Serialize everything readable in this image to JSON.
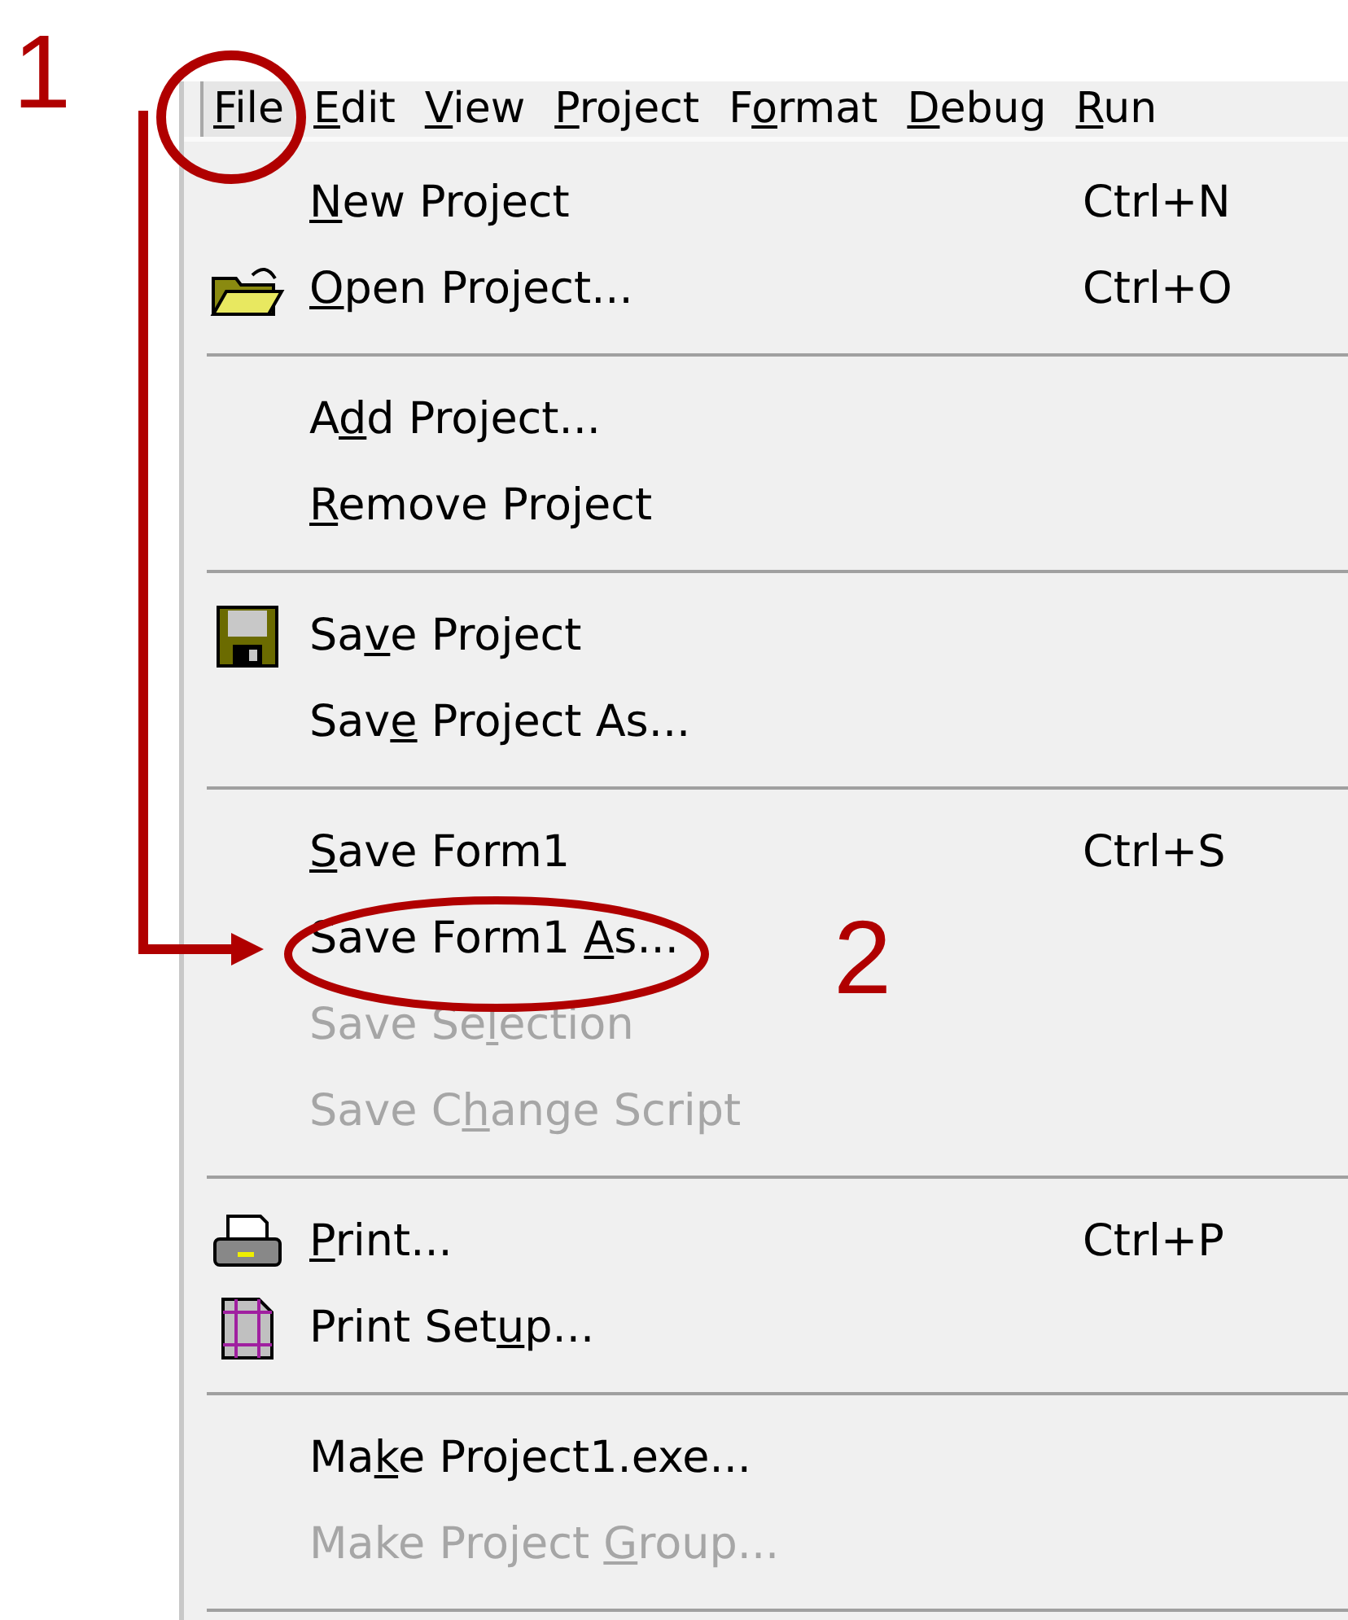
{
  "menu_bar": [
    {
      "key": "F",
      "post": "ile",
      "selected": true
    },
    {
      "key": "E",
      "post": "dit",
      "selected": false
    },
    {
      "key": "V",
      "post": "iew",
      "selected": false
    },
    {
      "key": "P",
      "post": "roject",
      "selected": false
    },
    {
      "pre": "F",
      "key": "o",
      "post": "rmat",
      "selected": false
    },
    {
      "key": "D",
      "post": "ebug",
      "selected": false
    },
    {
      "key": "R",
      "post": "un",
      "selected": false
    }
  ],
  "file_menu": {
    "groups": [
      [
        {
          "kind": "plain",
          "key": "N",
          "post": "ew Project",
          "shortcut": "Ctrl+N",
          "disabled": false
        },
        {
          "kind": "folder",
          "key": "O",
          "post": "pen Project...",
          "shortcut": "Ctrl+O",
          "disabled": false
        }
      ],
      [
        {
          "kind": "plain",
          "pre": "A",
          "key": "d",
          "post": "d Project...",
          "disabled": false
        },
        {
          "kind": "plain",
          "key": "R",
          "post": "emove Project",
          "disabled": false
        }
      ],
      [
        {
          "kind": "floppy",
          "pre": "Sa",
          "key": "v",
          "post": "e Project",
          "disabled": false
        },
        {
          "kind": "plain",
          "pre": "Sav",
          "key": "e",
          "post": " Project As...",
          "disabled": false
        }
      ],
      [
        {
          "kind": "plain",
          "key": "S",
          "post": "ave Form1",
          "shortcut": "Ctrl+S",
          "disabled": false
        },
        {
          "kind": "plain",
          "pre": "Save Form1 ",
          "key": "A",
          "post": "s...",
          "disabled": false
        },
        {
          "kind": "plain",
          "pre": "Save Se",
          "key": "l",
          "post": "ection",
          "disabled": true
        },
        {
          "kind": "plain",
          "pre": "Save C",
          "key": "h",
          "post": "ange Script",
          "disabled": true
        }
      ],
      [
        {
          "kind": "printer",
          "key": "P",
          "post": "rint...",
          "shortcut": "Ctrl+P",
          "disabled": false
        },
        {
          "kind": "page",
          "pre": "Print Set",
          "key": "u",
          "post": "p...",
          "disabled": false
        }
      ],
      [
        {
          "kind": "plain",
          "pre": "Ma",
          "key": "k",
          "post": "e Project1.exe...",
          "disabled": false
        },
        {
          "kind": "plain",
          "pre": "Make Project ",
          "key": "G",
          "post": "roup...",
          "disabled": true
        }
      ]
    ]
  },
  "annotations": [
    {
      "text": "1"
    },
    {
      "text": "2"
    }
  ]
}
